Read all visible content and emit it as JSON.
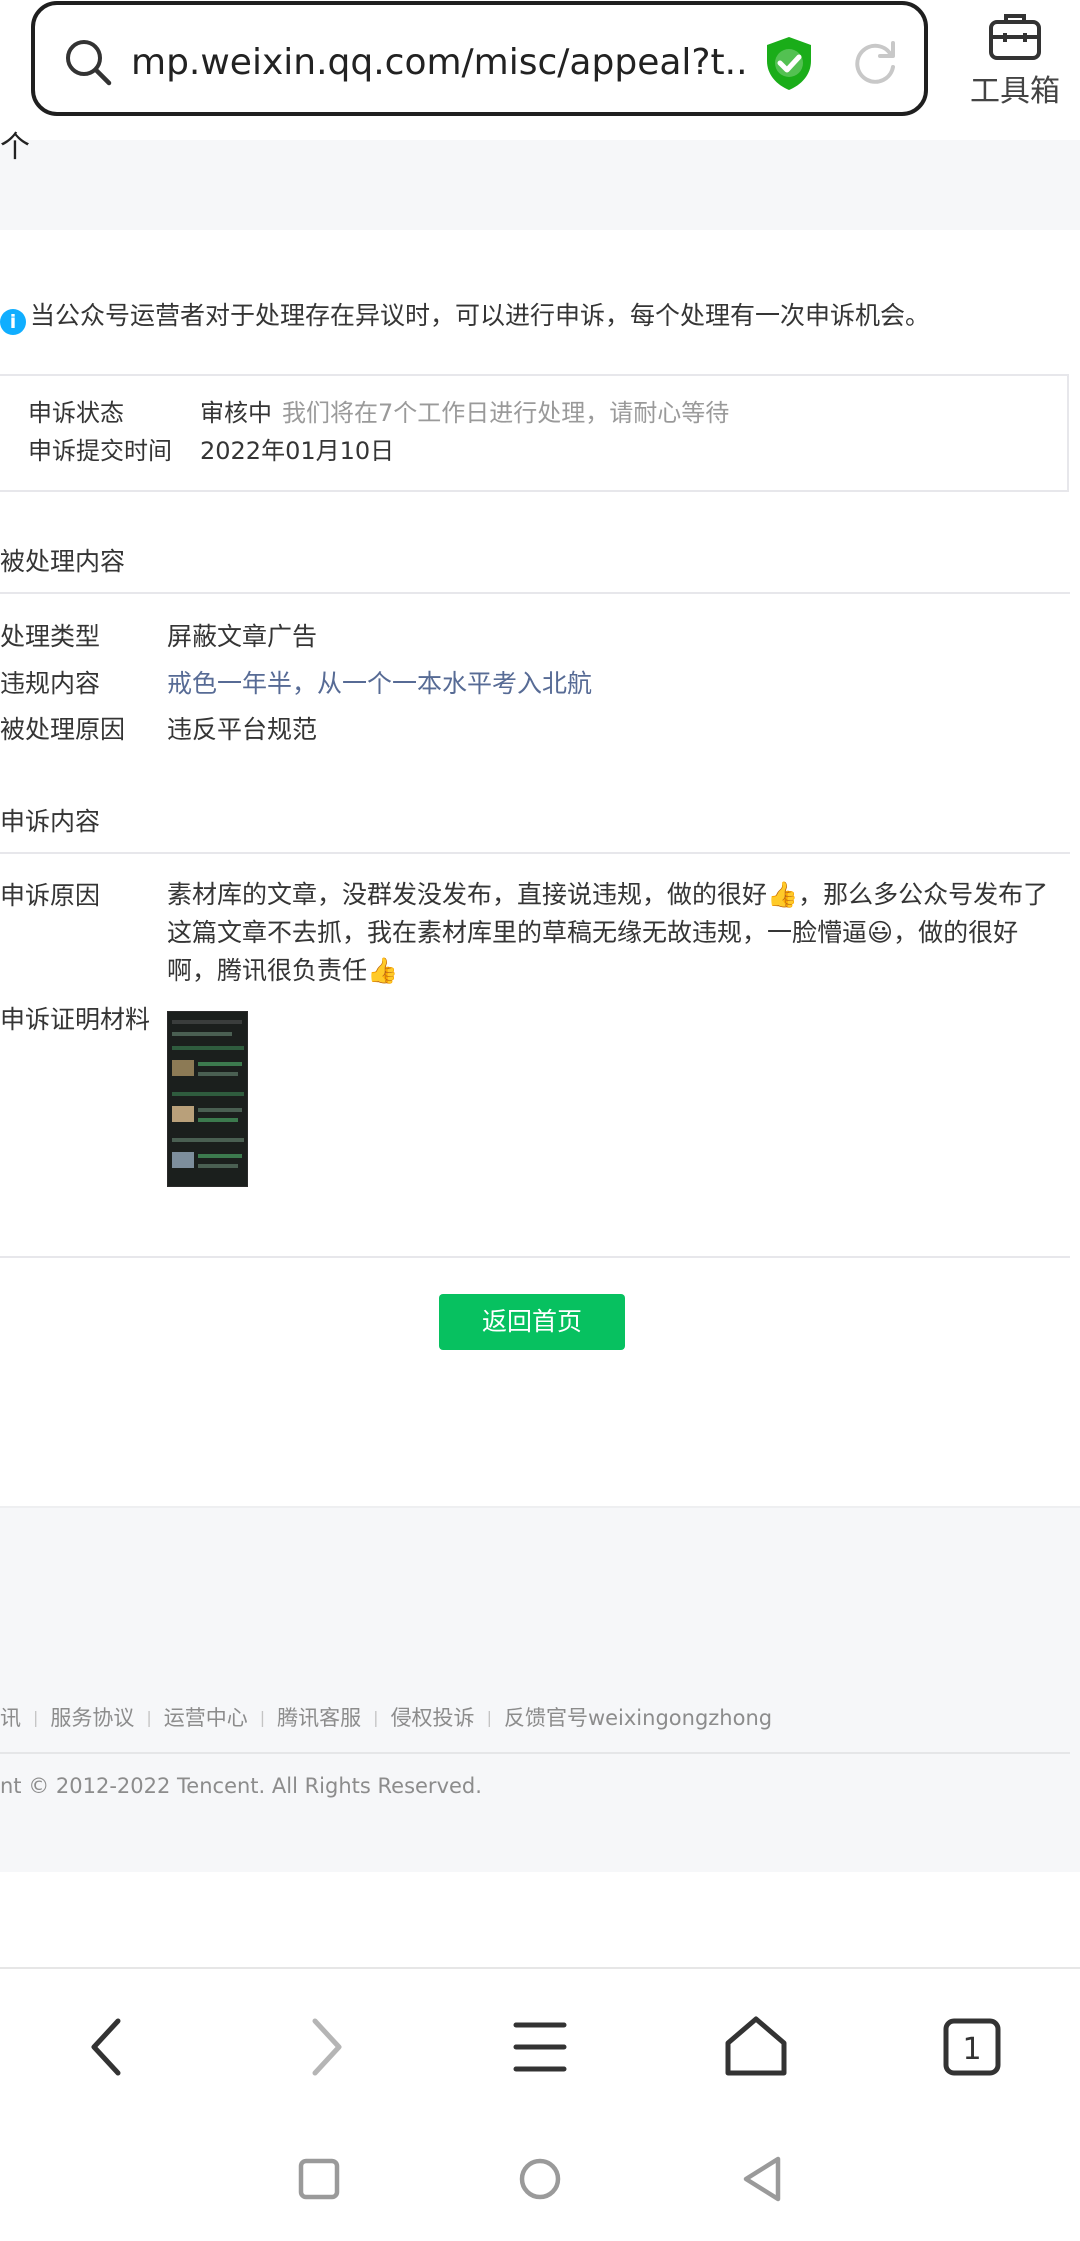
{
  "browser": {
    "url": "mp.weixin.qq.com/misc/appeal?t...",
    "toolbox_label": "工具箱",
    "tab_count": "1"
  },
  "page": {
    "cut_glyph": "个",
    "notice": "当公众号运营者对于处理存在异议时，可以进行申诉，每个处理有一次申诉机会。",
    "status": {
      "status_label": "申诉状态",
      "status_value": "审核中",
      "status_tip": "我们将在7个工作日进行处理，请耐心等待",
      "time_label": "申诉提交时间",
      "time_value": "2022年01月10日"
    },
    "processed": {
      "title": "被处理内容",
      "type_label": "处理类型",
      "type_value": "屏蔽文章广告",
      "content_label": "违规内容",
      "content_value": "戒色一年半，从一个一本水平考入北航",
      "reason_label": "被处理原因",
      "reason_value": "违反平台规范"
    },
    "appeal": {
      "title": "申诉内容",
      "reason_label": "申诉原因",
      "reason_text": "素材库的文章，没群发没发布，直接说违规，做的很好👍，那么多公众号发布了这篇文章不去抓，我在素材库里的草稿无缘无故违规，一脸懵逼😃，做的很好啊，腾讯很负责任👍",
      "evidence_label": "申诉证明材料"
    },
    "return_button": "返回首页"
  },
  "footer": {
    "links": [
      "讯",
      "服务协议",
      "运营中心",
      "腾讯客服",
      "侵权投诉",
      "反馈官号weixingongzhong"
    ],
    "copyright": "nt © 2012-2022 Tencent. All Rights Reserved."
  },
  "colors": {
    "accent_green": "#07c160",
    "link_blue": "#576b95",
    "info_blue": "#10aeff",
    "shield_green": "#1aad19"
  }
}
